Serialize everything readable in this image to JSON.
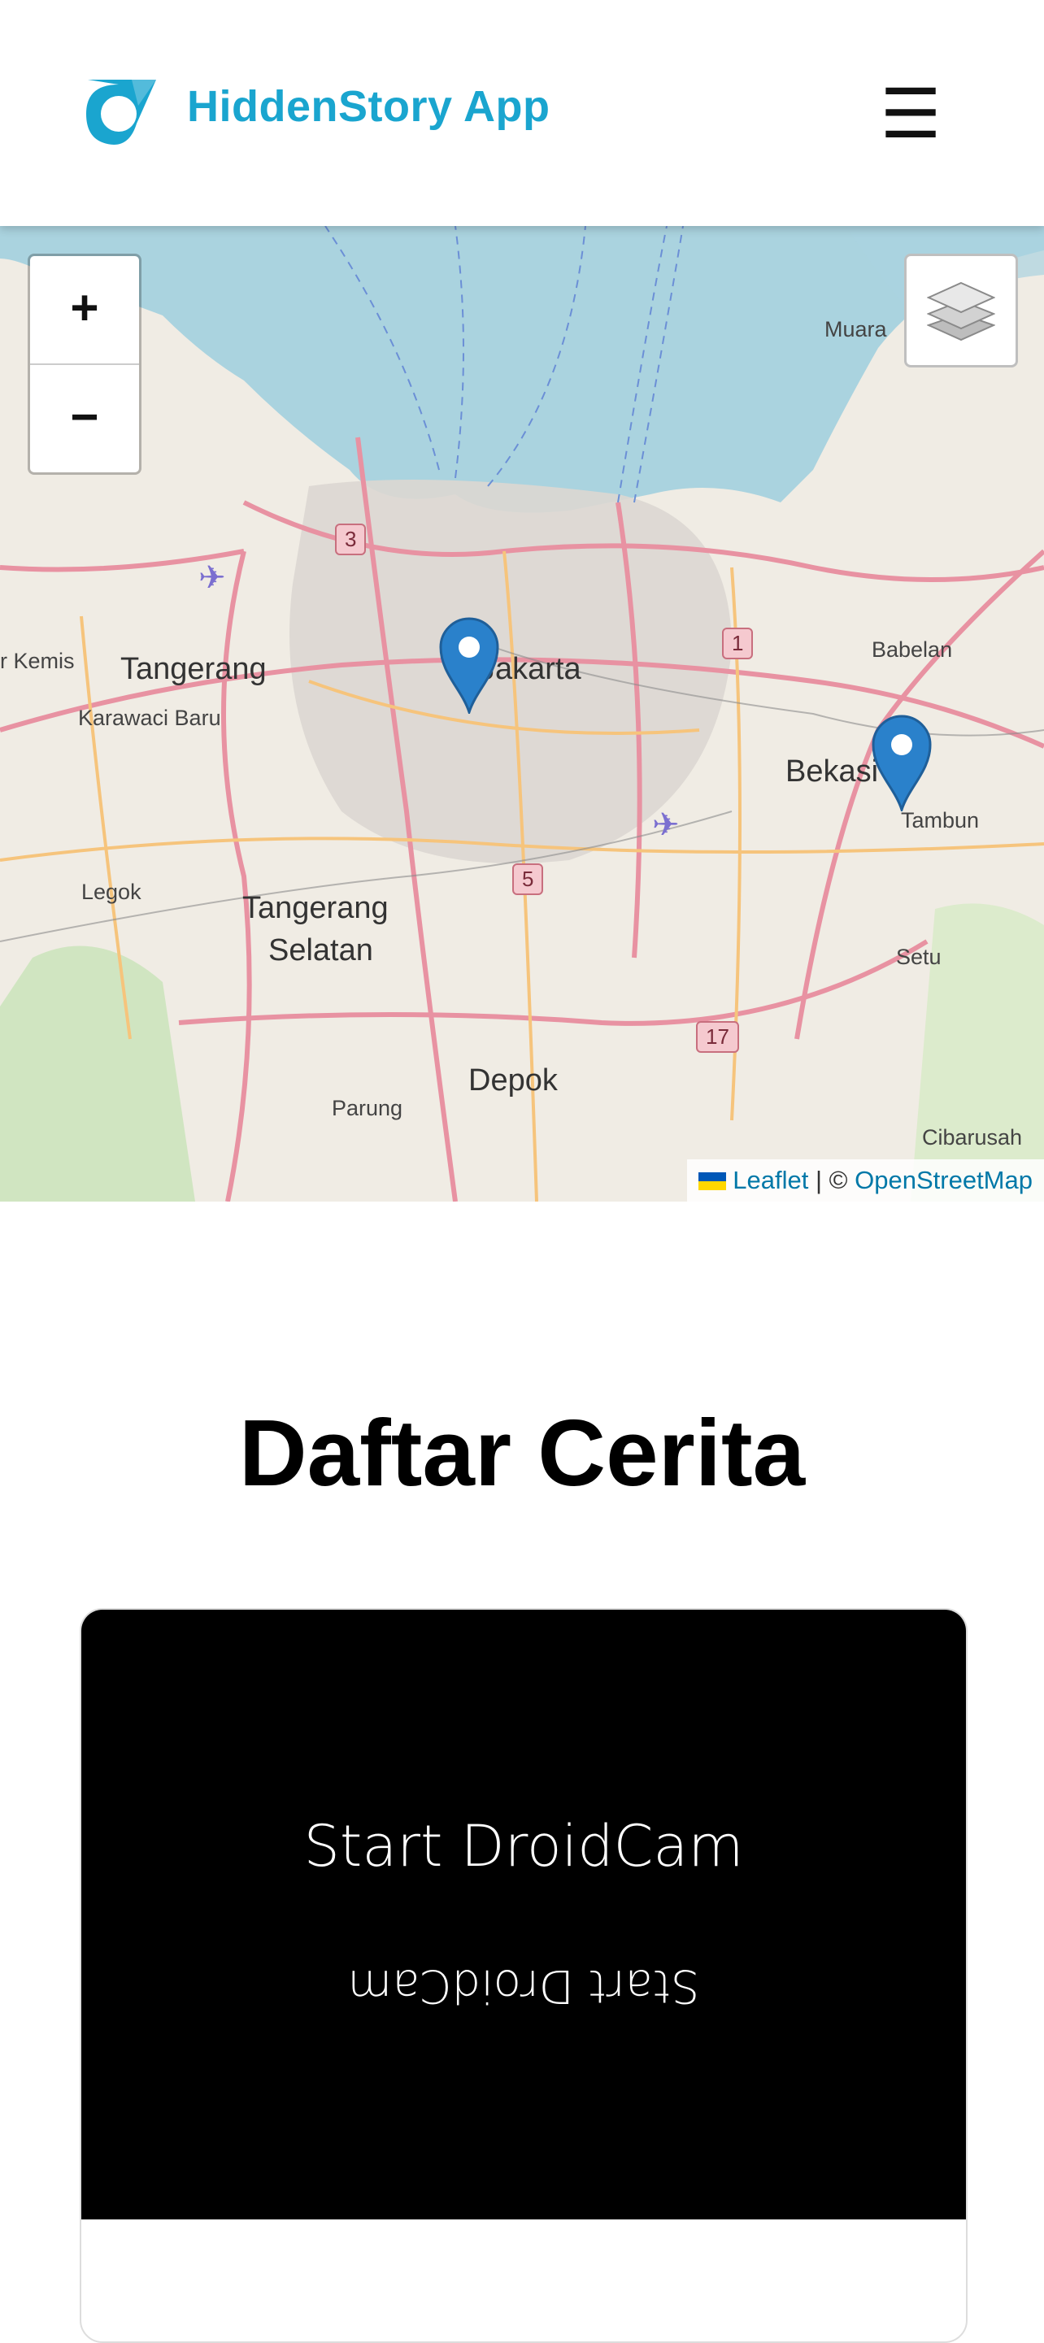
{
  "header": {
    "brand": "HiddenStory App",
    "menu_icon": "☰"
  },
  "map": {
    "zoom_in": "+",
    "zoom_out": "−",
    "places": {
      "tangerang": "Tangerang",
      "karawaci": "Karawaci Baru",
      "kemis": "r Kemis",
      "jakarta": "Jakarta",
      "babelan": "Babelan",
      "bekasi": "Bekasi",
      "tambun": "Tambun",
      "muara": "Muara",
      "legok": "Legok",
      "tangsel1": "Tangerang",
      "tangsel2": "Selatan",
      "setu": "Setu",
      "depok": "Depok",
      "parung": "Parung",
      "cibarusah": "Cibarusah"
    },
    "shields": [
      "3",
      "1",
      "5",
      "17"
    ],
    "attribution": {
      "leaflet": "Leaflet",
      "separator": "| ©",
      "osm": "OpenStreetMap"
    }
  },
  "section": {
    "title": "Daftar Cerita"
  },
  "story": {
    "image_text": "Start DroidCam",
    "image_text_mirrored": "Start DroidCam"
  },
  "colors": {
    "brand": "#1aa5cf",
    "marker": "#2a81cb",
    "water": "#aad3df"
  }
}
